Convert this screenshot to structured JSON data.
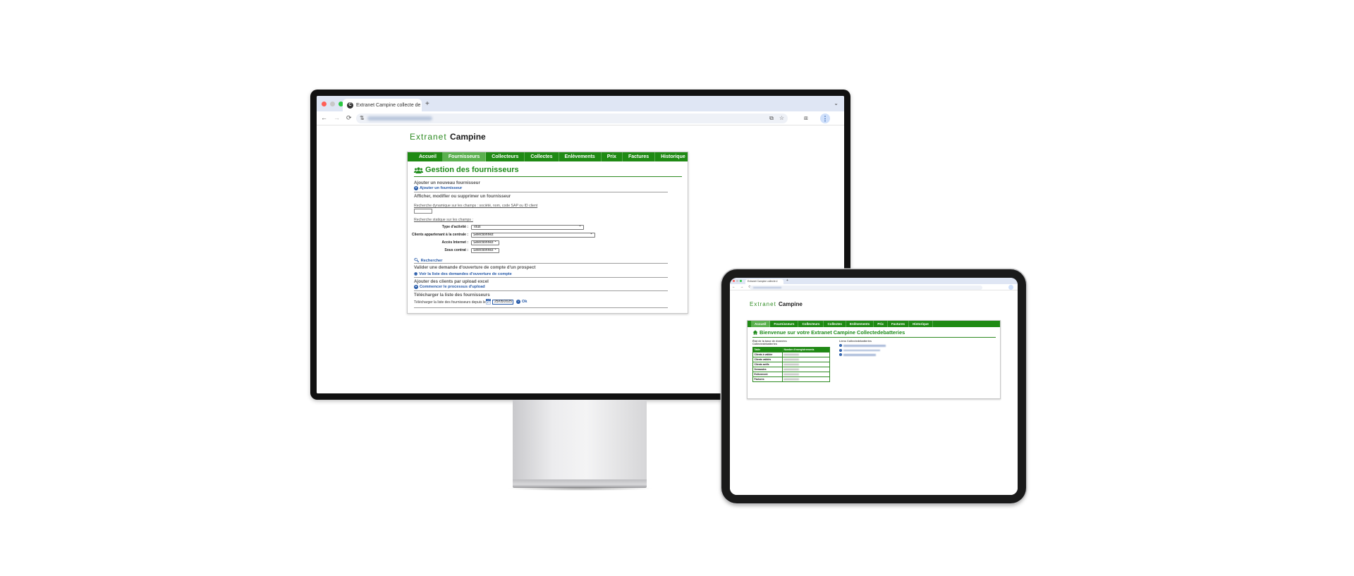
{
  "desktop": {
    "browser": {
      "tab_title": "Extranet Campine collecte de",
      "tab_favicon": "C",
      "tab_close": "×",
      "new_tab": "+",
      "tab_list": "⌄",
      "nav": {
        "back": "←",
        "forward": "→",
        "reload": "⟳"
      },
      "site_info": "⇅",
      "toolbar_icons": {
        "translate": "⧉",
        "bookmark": "☆",
        "extensions": "⧈",
        "menu": "⋮"
      }
    },
    "logo": {
      "part1": "Extranet ",
      "part2": "Campine"
    },
    "menu": [
      "Accueil",
      "Fournisseurs",
      "Collecteurs",
      "Collectes",
      "Enlèvements",
      "Prix",
      "Factures",
      "Historique"
    ],
    "active_menu": "Fournisseurs",
    "page_title": "Gestion des fournisseurs",
    "sections": {
      "add_title": "Ajouter un nouveau fournisseur",
      "add_link": "Ajouter un fournisseur",
      "manage_title": "Afficher, modifier ou supprimer un fournisseur",
      "dynamic_search": "Recherche dynamique sur les champs : société, nom, code SAP ou ID client",
      "static_search": "Recherche statique sur les champs :",
      "search_button": "Rechercher",
      "validate_title": "Valider une demande d'ouverture de compte d'un prospect",
      "validate_link": "Voir la liste des demandes d'ouverture de compte",
      "upload_title": "Ajouter des clients par upload excel",
      "upload_link": "Commencer le processus d'upload",
      "download_title": "Télécharger la liste des fournisseurs",
      "download_text": "Télécharger la liste des fournisseurs depuis le",
      "download_date": "25/05/2025",
      "download_ok": "Ok"
    },
    "filters": [
      {
        "label": "Type d'activité :",
        "value": "Tous"
      },
      {
        "label": "Clients appartenant à la centrale :",
        "value": "Sélectionnez"
      },
      {
        "label": "Accès Internet :",
        "value": "Sélectionnez"
      },
      {
        "label": "Sous contrat :",
        "value": "Sélectionnez"
      }
    ]
  },
  "tablet": {
    "tab_title": "Extranet Campine collecte d",
    "logo": {
      "part1": "Extranet ",
      "part2": "Campine"
    },
    "menu": [
      "Accueil",
      "Fournisseurs",
      "Collecteurs",
      "Collectes",
      "Enlèvements",
      "Prix",
      "Factures",
      "Historique"
    ],
    "active_menu": "Accueil",
    "page_title": "Bienvenue sur votre Extranet Campine Collectedebatteries",
    "left_title_1": "État de la base de données",
    "left_title_2": "Collectedebatteries",
    "table_headers": [
      "Table",
      "Nombre d'enregistrements"
    ],
    "table_rows": [
      "Clients à valider",
      "Clients validés",
      "Clients actifs",
      "Demandes",
      "Enlèvement",
      "Factures"
    ],
    "right_title": "Liens Collectedebatteries"
  },
  "colors": {
    "brand_green": "#1f8a14",
    "title_green": "#1e8c1a",
    "link_blue": "#2559a8",
    "active_tab": "#5bb04f"
  }
}
